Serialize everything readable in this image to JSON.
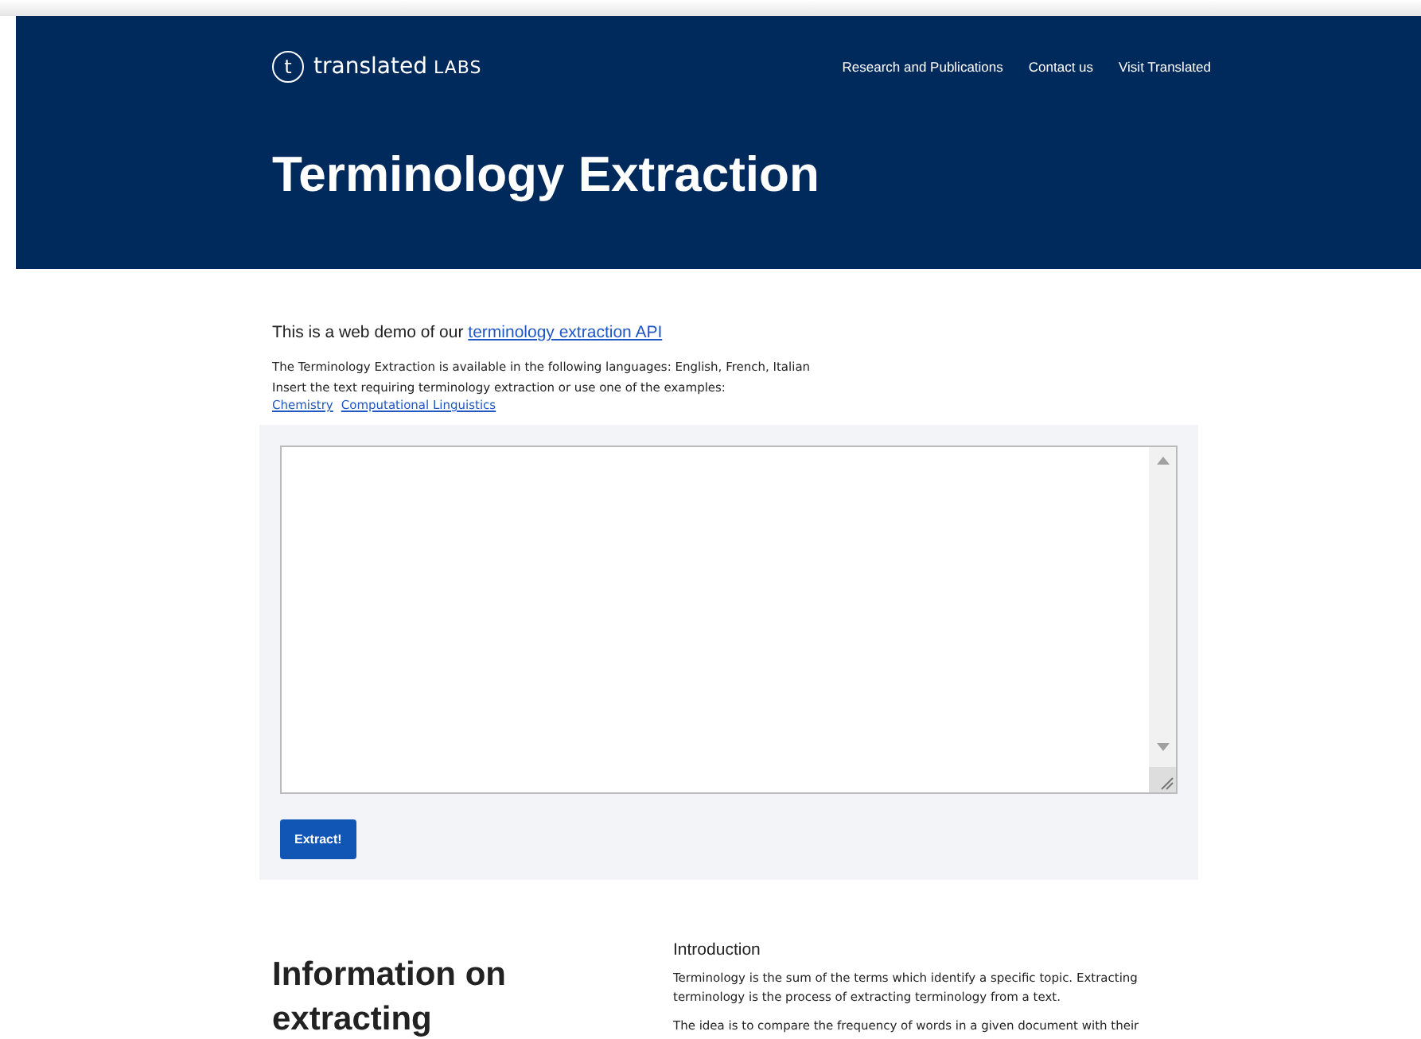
{
  "header": {
    "logo_mark": "t",
    "logo_text": "translated",
    "logo_suffix": "LABS",
    "nav": [
      "Research and Publications",
      "Contact us",
      "Visit Translated"
    ],
    "title": "Terminology Extraction"
  },
  "intro": {
    "lead": "This is a web demo of our",
    "lead_link": "terminology extraction API",
    "languages": "The Terminology Extraction is available in the following languages: English, French, Italian",
    "instruction": "Insert the text requiring terminology extraction or use one of the examples:",
    "examples": [
      "Chemistry",
      "Computational Linguistics"
    ]
  },
  "form": {
    "button": "Extract!"
  },
  "info": {
    "heading": "Information on extracting",
    "section_title": "Introduction",
    "paragraphs": [
      "Terminology is the sum of the terms which identify a specific topic. Extracting terminology is the process of extracting terminology from a text.",
      "The idea is to compare the frequency of words in a given document with their"
    ]
  }
}
